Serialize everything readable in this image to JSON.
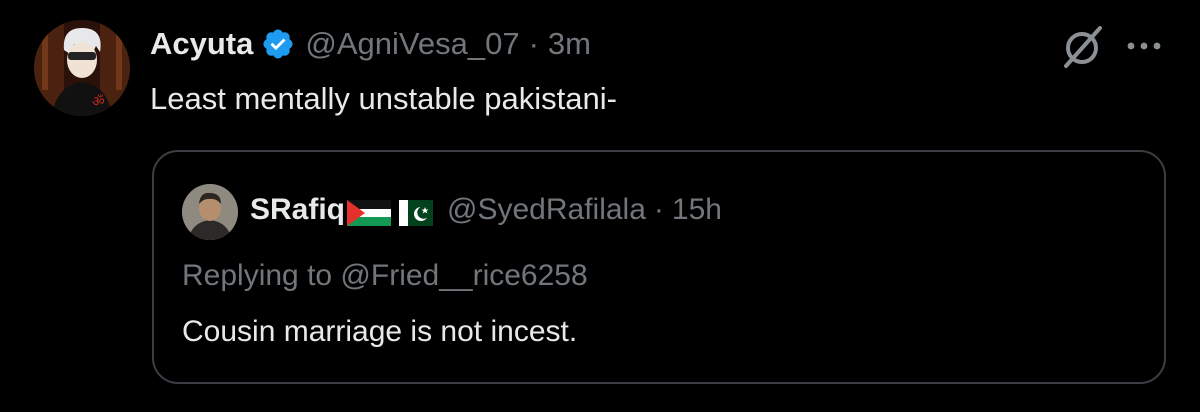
{
  "tweet": {
    "display_name": "Acyuta",
    "handle": "@AgniVesa_07",
    "separator": "·",
    "time": "3m",
    "text": "Least mentally unstable pakistani-",
    "avatar_icon": "anime-character-avatar",
    "verified_icon": "verified-badge-icon",
    "grok_icon": "grok-icon",
    "more_icon": "more-options-icon"
  },
  "quote": {
    "display_name": "SRafiq",
    "flags": [
      "palestine-flag",
      "pakistan-flag"
    ],
    "handle": "@SyedRafilala",
    "separator": "·",
    "time": "15h",
    "replying_to": "Replying to @Fried__rice6258",
    "text": "Cousin marriage is not incest."
  },
  "colors": {
    "background": "#000000",
    "primary_text": "#e7e9ea",
    "secondary_text": "#71767b",
    "verified_blue": "#1d9bf0",
    "quote_border": "#3b3f44"
  }
}
